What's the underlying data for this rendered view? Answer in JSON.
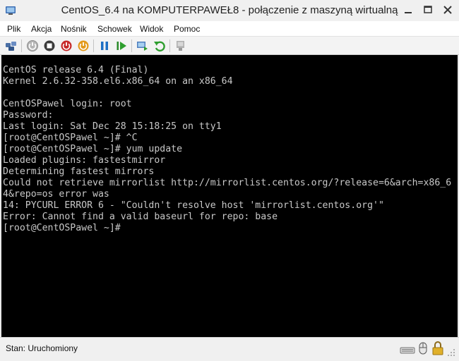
{
  "window": {
    "title": "CentOS_6.4 na KOMPUTERPAWEŁ8 - połączenie z maszyną wirtualną"
  },
  "menu": {
    "items": [
      "Plik",
      "Akcja",
      "Nośnik",
      "Schowek",
      "Widok",
      "Pomoc"
    ]
  },
  "toolbar": {
    "buttons": [
      "ctrl-alt-del-icon",
      "start-icon",
      "turn-off-icon",
      "shut-down-icon",
      "power-icon",
      "pause-icon",
      "resume-icon",
      "snapshot-icon",
      "revert-icon",
      "enhanced-session-icon"
    ]
  },
  "console": {
    "lines": [
      "CentOS release 6.4 (Final)",
      "Kernel 2.6.32-358.el6.x86_64 on an x86_64",
      "",
      "CentOSPawel login: root",
      "Password:",
      "Last login: Sat Dec 28 15:18:25 on tty1",
      "[root@CentOSPawel ~]# ^C",
      "[root@CentOSPawel ~]# yum update",
      "Loaded plugins: fastestmirror",
      "Determining fastest mirrors",
      "Could not retrieve mirrorlist http://mirrorlist.centos.org/?release=6&arch=x86_6",
      "4&repo=os error was",
      "14: PYCURL ERROR 6 - \"Couldn't resolve host 'mirrorlist.centos.org'\"",
      "Error: Cannot find a valid baseurl for repo: base",
      "[root@CentOSPawel ~]#"
    ]
  },
  "status": {
    "text": "Stan: Uruchomiony"
  },
  "colors": {
    "console_bg": "#000000",
    "console_fg": "#c8c8c8",
    "close_red": "#c0392b"
  }
}
